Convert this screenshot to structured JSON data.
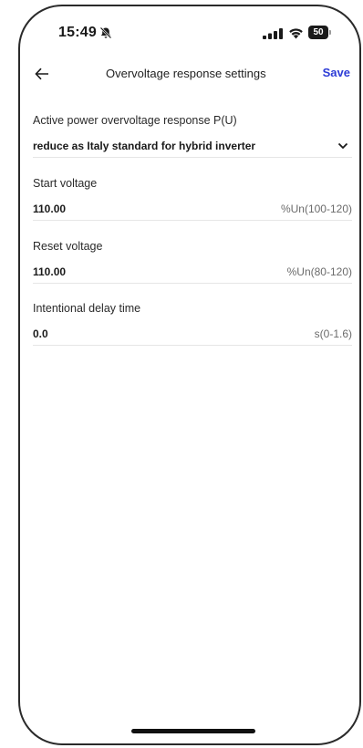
{
  "status_bar": {
    "time": "15:49",
    "battery": "50",
    "icons": [
      "bell-slash-icon",
      "signal-icon",
      "wifi-icon",
      "battery-icon"
    ]
  },
  "header": {
    "back_icon": "arrow-left-icon",
    "title": "Overvoltage response settings",
    "save_label": "Save",
    "accent_color": "#2c3bd6"
  },
  "fields": [
    {
      "label": "Active power overvoltage response P(U)",
      "value": "reduce as Italy standard for hybrid inverter",
      "type": "select",
      "icon": "chevron-down-icon"
    },
    {
      "label": "Start voltage",
      "value": "110.00",
      "unit": "%Un(100-120)",
      "type": "number"
    },
    {
      "label": "Reset voltage",
      "value": "110.00",
      "unit": "%Un(80-120)",
      "type": "number"
    },
    {
      "label": "Intentional delay time",
      "value": "0.0",
      "unit": "s(0-1.6)",
      "type": "number"
    }
  ]
}
